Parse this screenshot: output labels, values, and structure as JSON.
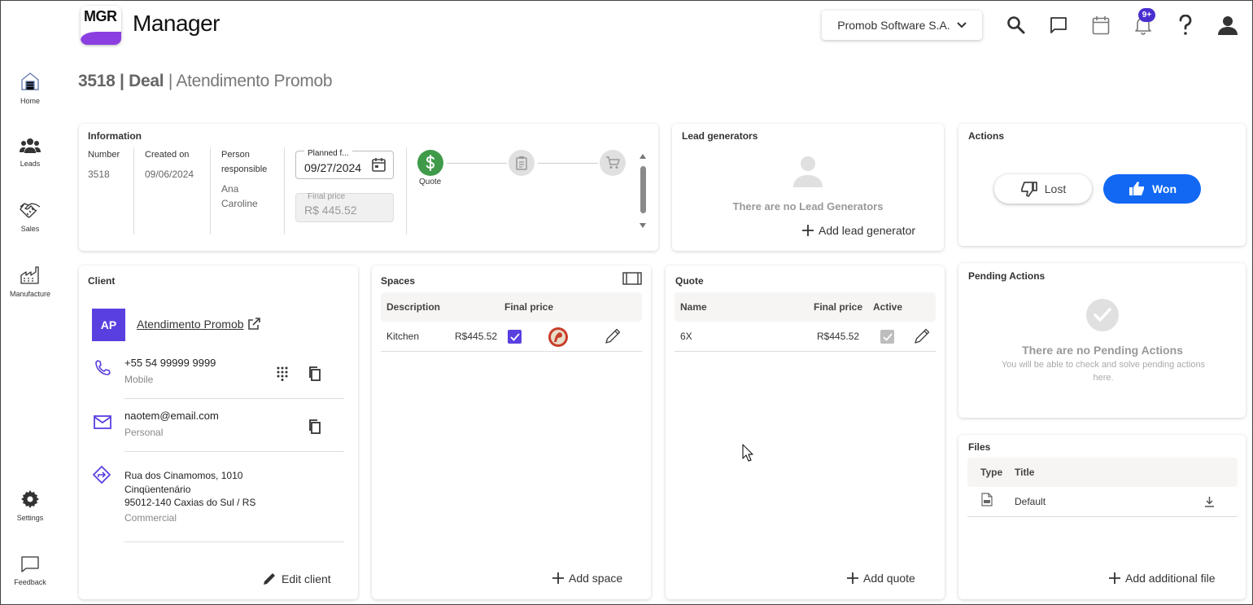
{
  "header": {
    "logo_text": "MGR",
    "app_title": "Manager",
    "company": "Promob Software S.A.",
    "notification_count": "9+"
  },
  "sidebar": {
    "items": [
      {
        "label": "Home"
      },
      {
        "label": "Leads"
      },
      {
        "label": "Sales"
      },
      {
        "label": "Manufacture"
      }
    ],
    "bottom": [
      {
        "label": "Settings"
      },
      {
        "label": "Feedback"
      }
    ]
  },
  "page": {
    "number_title": "3518 | Deal",
    "subtitle": " | Atendimento Promob"
  },
  "information": {
    "title": "Information",
    "number_label": "Number",
    "number_value": "3518",
    "created_label": "Created on",
    "created_value": "09/06/2024",
    "person_label_1": "Person",
    "person_label_2": "responsible",
    "person_value_1": "Ana",
    "person_value_2": "Caroline",
    "planned_label": "Planned f...",
    "planned_value": "09/27/2024",
    "final_price_label": "Final price",
    "final_price_value": "R$ 445.52",
    "step_quote_label": "Quote"
  },
  "lead_generators": {
    "title": "Lead generators",
    "empty": "There are no Lead Generators",
    "add": "Add lead generator"
  },
  "actions": {
    "title": "Actions",
    "lost": "Lost",
    "won": "Won"
  },
  "pending": {
    "title": "Pending Actions",
    "empty": "There are no Pending Actions",
    "hint_1": "You will be able to check and solve pending actions",
    "hint_2": "here."
  },
  "client": {
    "title": "Client",
    "initials": "AP",
    "name": "Atendimento Promob",
    "phone": "+55 54 99999 9999",
    "phone_type": "Mobile",
    "email": "naotem@email.com",
    "email_type": "Personal",
    "address_1": "Rua dos Cinamomos, 1010",
    "address_2": "Cinqüentenário",
    "address_3": "95012-140 Caxias do Sul / RS",
    "address_type": "Commercial",
    "edit": "Edit client"
  },
  "spaces": {
    "title": "Spaces",
    "columns": [
      "Description",
      "Final price"
    ],
    "rows": [
      {
        "description": "Kitchen",
        "price": "R$445.52"
      }
    ],
    "add": "Add space"
  },
  "quote": {
    "title": "Quote",
    "columns": [
      "Name",
      "Final price",
      "Active"
    ],
    "rows": [
      {
        "name": "6X",
        "price": "R$445.52"
      }
    ],
    "add": "Add quote"
  },
  "files": {
    "title": "Files",
    "columns": [
      "Type",
      "Title"
    ],
    "rows": [
      {
        "title": "Default"
      }
    ],
    "add": "Add additional file"
  },
  "colors": {
    "accent": "#5a3fe0",
    "won": "#1268f3",
    "quote_step": "#3f9a4a"
  }
}
